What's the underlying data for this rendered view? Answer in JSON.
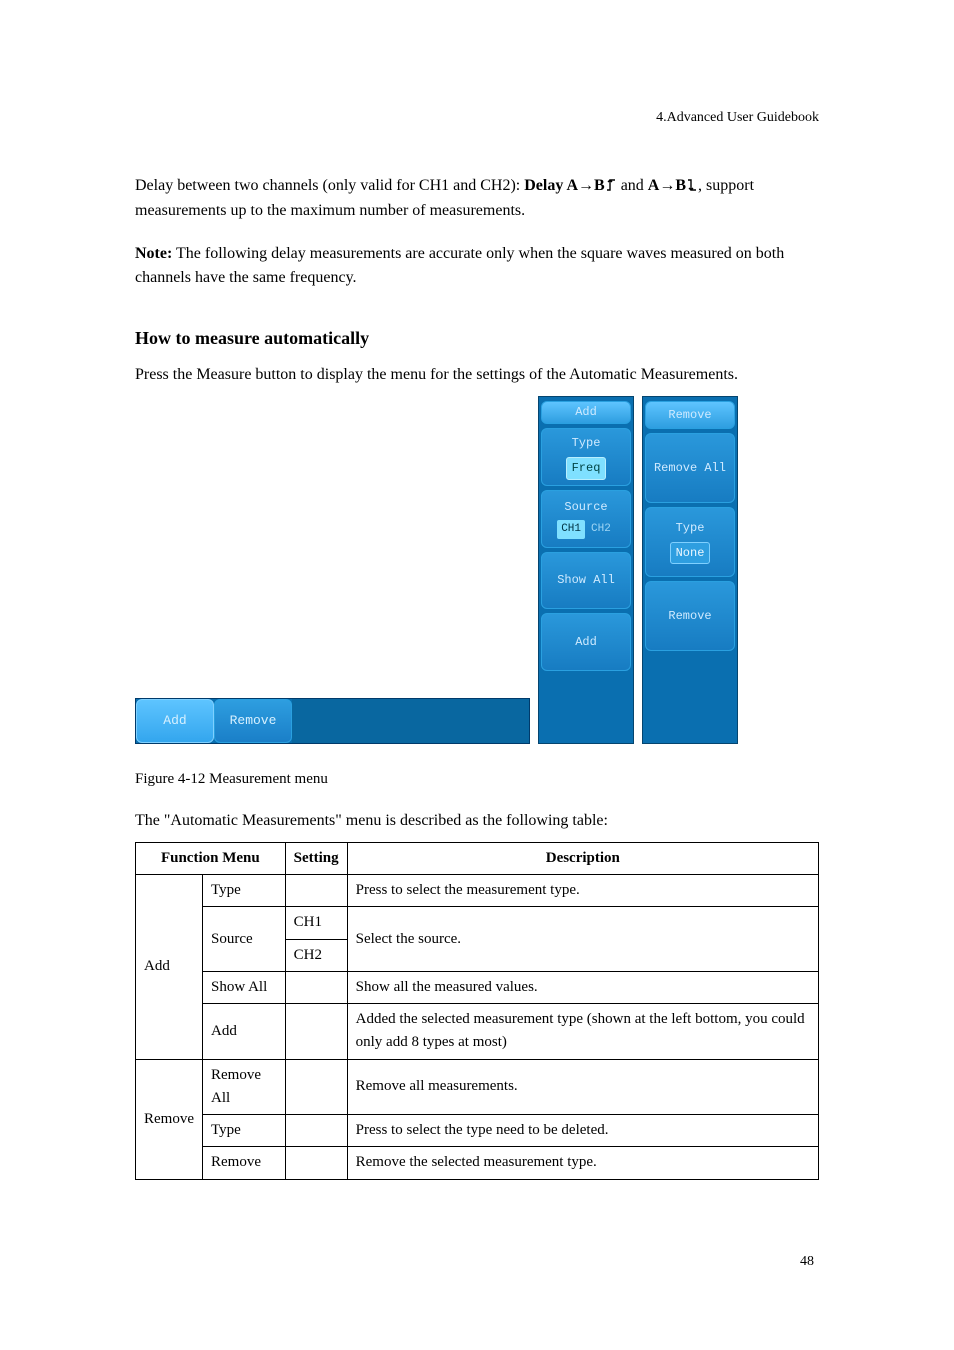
{
  "header": "4.Advanced User Guidebook",
  "para1_a": "Delay between two channels (only valid for CH1 and CH2):",
  "para1_b": "Delay A→B",
  "para1_c": "and",
  "para1_d": "A→B",
  "para1_e": ", support measurements up to the maximum number of measurements.",
  "note_label": "Note:",
  "note_text": " The following delay measurements are accurate only when the square waves measured on both channels have the same frequency.",
  "heading": "How to measure automatically",
  "howto": "Press the Measure button to display the menu for the settings of the Automatic Measurements.",
  "hmenu": {
    "add": "Add",
    "remove": "Remove"
  },
  "vmenu_add": {
    "head": "Add",
    "type_label": "Type",
    "type_value": "Freq",
    "source_label": "Source",
    "source_sel": "CH1",
    "source_uns": "CH2",
    "showall": "Show All",
    "add": "Add"
  },
  "vmenu_remove": {
    "head": "Remove",
    "removeall": "Remove All",
    "type_label": "Type",
    "type_value": "None",
    "remove": "Remove"
  },
  "figcap": "Figure 4-12 Measurement menu",
  "table_cap": "The \"Automatic Measurements\" menu is described as the following table:",
  "table": {
    "head": [
      "Function Menu",
      "Setting",
      "Description"
    ],
    "rows": [
      [
        "Add",
        "Type",
        "",
        "Press to select the measurement type."
      ],
      [
        "",
        "Source",
        "CH1",
        "Select the source (rowspan)."
      ],
      [
        "",
        "",
        "CH2",
        ""
      ],
      [
        "",
        "Show All",
        "",
        "Show all the measured values."
      ],
      [
        "",
        "Add",
        "",
        "Added the selected measurement type (shown at the left bottom, you could only add 8 types at most)"
      ],
      [
        "Remove",
        "Remove All",
        "",
        "Remove all measurements."
      ],
      [
        "",
        "Type",
        "",
        "Press to select the type need to be deleted."
      ],
      [
        "",
        "Remove",
        "",
        "Remove the selected measurement type."
      ]
    ],
    "source_desc": "Select the source."
  },
  "page_num": "48"
}
